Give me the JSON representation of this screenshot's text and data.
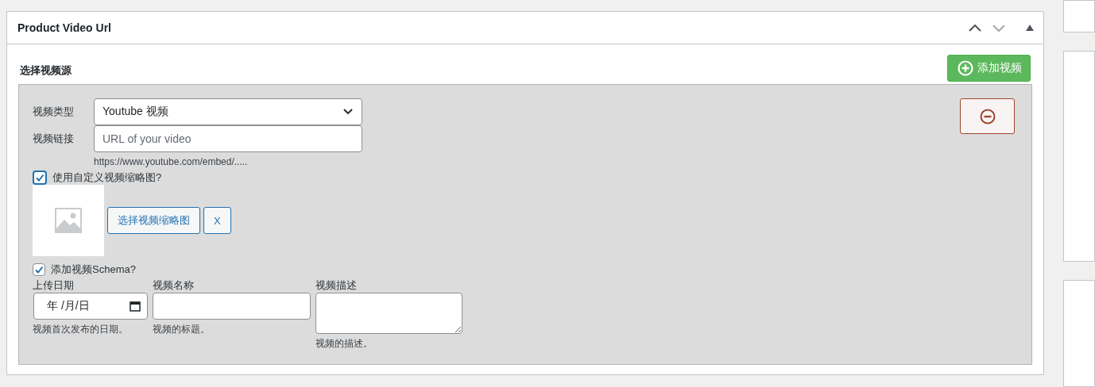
{
  "panel": {
    "title": "Product Video Url"
  },
  "section_label": "选择视频源",
  "add_button": "添加视频",
  "video_type": {
    "label": "视频类型",
    "value": "Youtube 视频"
  },
  "video_link": {
    "label": "视频链接",
    "placeholder": "URL of your video",
    "hint": "https://www.youtube.com/embed/....."
  },
  "custom_thumbnail": {
    "label": "使用自定义视频缩略图?",
    "checked": true
  },
  "thumbnail_buttons": [
    "选择视频缩略图",
    "X"
  ],
  "schema": {
    "label": "添加视频Schema?",
    "checked": true
  },
  "schema_fields": [
    {
      "kind": "date",
      "label": "上传日期",
      "placeholder": "年 /月/日",
      "hint": "视频首次发布的日期。"
    },
    {
      "kind": "text",
      "label": "视频名称",
      "hint": "视频的标题。"
    },
    {
      "kind": "textarea",
      "label": "视频描述",
      "hint": "视频的描述。"
    }
  ]
}
